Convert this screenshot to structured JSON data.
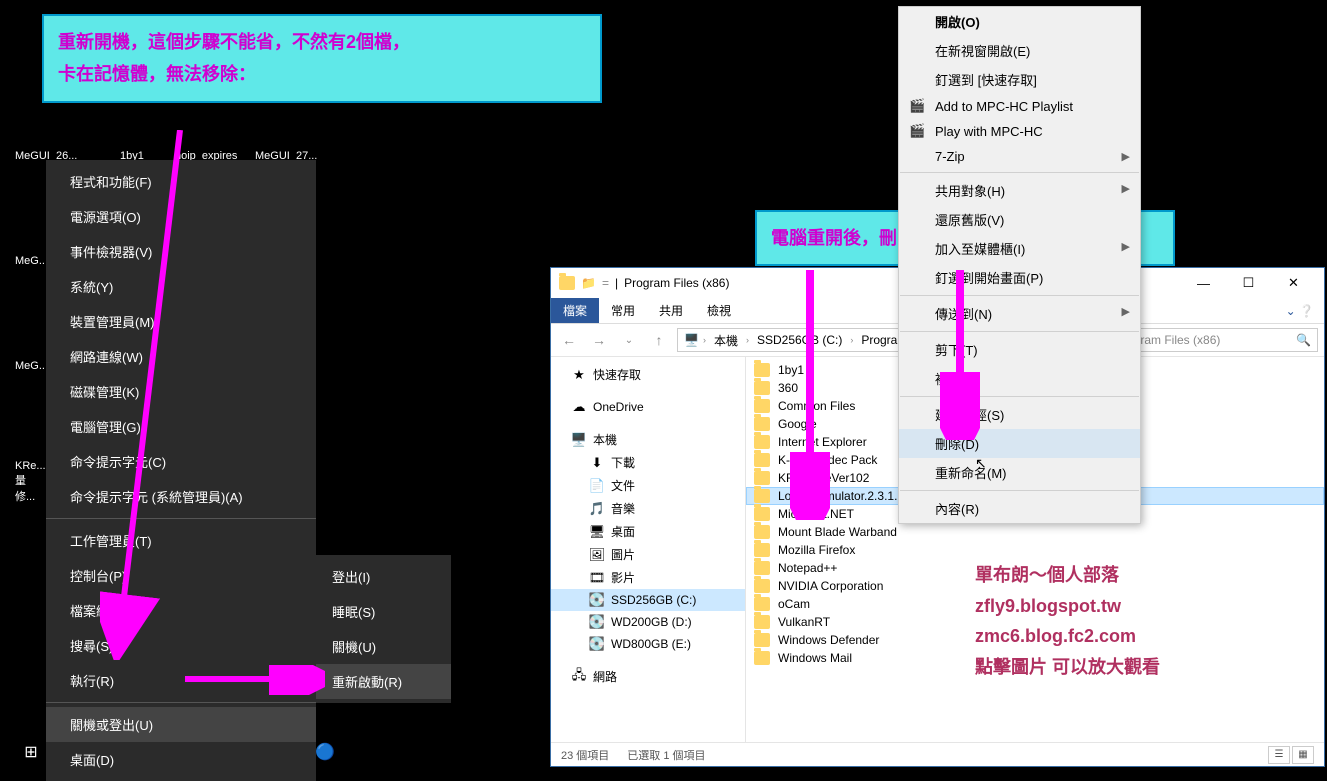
{
  "callouts": {
    "c1_line1": "重新開機，這個步驟不能省，不然有2個檔，",
    "c1_line2": "卡在記憶體，無法移除：",
    "c2": "電腦重開後，刪除舊版之目錄。"
  },
  "desktop": {
    "labels": [
      "MeGUI_26...",
      "1by1",
      "noip_expires",
      "MeGUI_27...",
      "MeG...",
      "MeG...",
      "KRe... 量修..."
    ]
  },
  "winx": {
    "items": [
      "程式和功能(F)",
      "電源選項(O)",
      "事件檢視器(V)",
      "系統(Y)",
      "裝置管理員(M)",
      "網路連線(W)",
      "磁碟管理(K)",
      "電腦管理(G)",
      "命令提示字元(C)",
      "命令提示字元 (系統管理員)(A)"
    ],
    "items2": [
      "工作管理員(T)",
      "控制台(P)",
      "檔案總管(E)",
      "搜尋(S)",
      "執行(R)"
    ],
    "items3": [
      "關機或登出(U)",
      "桌面(D)"
    ],
    "submenu": [
      "登出(I)",
      "睡眠(S)",
      "關機(U)",
      "重新啟動(R)"
    ]
  },
  "ctx": {
    "open": "開啟(O)",
    "open_new": "在新視窗開啟(E)",
    "pin_quick": "釘選到 [快速存取]",
    "mpc_add": "Add to MPC-HC Playlist",
    "mpc_play": "Play with MPC-HC",
    "seven_zip": "7-Zip",
    "share_with": "共用對象(H)",
    "restore_prev": "還原舊版(V)",
    "add_library": "加入至媒體櫃(I)",
    "pin_start": "釘選到開始畫面(P)",
    "send_to": "傳送到(N)",
    "cut": "剪下(T)",
    "copy": "複製(C)",
    "create_shortcut": "建立捷徑(S)",
    "delete": "刪除(D)",
    "rename": "重新命名(M)",
    "properties": "內容(R)"
  },
  "explorer": {
    "title": "Program Files (x86)",
    "tabs": {
      "file": "檔案",
      "home": "常用",
      "share": "共用",
      "view": "檢視"
    },
    "breadcrumb": [
      "本機",
      "SSD256GB (C:)",
      "Program F..."
    ],
    "search_placeholder": "Program Files (x86)",
    "nav": {
      "quick": "快速存取",
      "onedrive": "OneDrive",
      "thispc": "本機",
      "downloads": "下載",
      "documents": "文件",
      "music": "音樂",
      "desktop": "桌面",
      "pictures": "圖片",
      "videos": "影片",
      "ssd": "SSD256GB (C:)",
      "wd200": "WD200GB (D:)",
      "wd800": "WD800GB (E:)",
      "network": "網路"
    },
    "files": [
      "1by1",
      "360",
      "Common Files",
      "Google",
      "Internet Explorer",
      "K-Lite Codec Pack",
      "KRenameVer102",
      "Locale.Emulator.2.3.1.1",
      "Microsoft.NET",
      "Mount Blade Warband",
      "Mozilla Firefox",
      "Notepad++",
      "NVIDIA Corporation",
      "oCam",
      "VulkanRT",
      "Windows Defender",
      "Windows Mail"
    ],
    "status": {
      "count": "23 個項目",
      "selected": "已選取 1 個項目"
    }
  },
  "blog": {
    "l1": "單布朗～個人部落",
    "l2": "zfly9.blogspot.tw",
    "l3": "zmc6.blog.fc2.com",
    "l4": "點擊圖片 可以放大觀看"
  }
}
